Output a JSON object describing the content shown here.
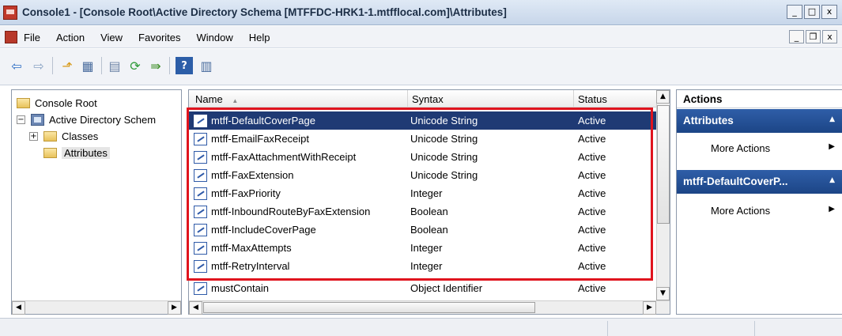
{
  "window": {
    "title": "Console1 - [Console Root\\Active Directory Schema [MTFFDC-HRK1-1.mtfflocal.com]\\Attributes]",
    "controls": [
      "_",
      "□",
      "x"
    ],
    "mdi_controls": [
      "_",
      "ð",
      "x"
    ]
  },
  "menu": {
    "items": [
      "File",
      "Action",
      "View",
      "Favorites",
      "Window",
      "Help"
    ]
  },
  "toolbar": {
    "icons": [
      "back-icon",
      "forward-icon",
      "up-folder-icon",
      "show-hide-tree-icon",
      "properties-icon",
      "refresh-icon",
      "export-icon",
      "help-icon",
      "show-hide-action-pane-icon"
    ]
  },
  "tree": {
    "root": "Console Root",
    "schema": "Active Directory Schem",
    "classes": "Classes",
    "attributes": "Attributes"
  },
  "list": {
    "columns": [
      "Name",
      "Syntax",
      "Status"
    ],
    "sort_indicator": "▲",
    "rows": [
      {
        "name": "mtff-DefaultCoverPage",
        "syntax": "Unicode String",
        "status": "Active"
      },
      {
        "name": "mtff-EmailFaxReceipt",
        "syntax": "Unicode String",
        "status": "Active"
      },
      {
        "name": "mtff-FaxAttachmentWithReceipt",
        "syntax": "Unicode String",
        "status": "Active"
      },
      {
        "name": "mtff-FaxExtension",
        "syntax": "Unicode String",
        "status": "Active"
      },
      {
        "name": "mtff-FaxPriority",
        "syntax": "Integer",
        "status": "Active"
      },
      {
        "name": "mtff-InboundRouteByFaxExtension",
        "syntax": "Boolean",
        "status": "Active"
      },
      {
        "name": "mtff-IncludeCoverPage",
        "syntax": "Boolean",
        "status": "Active"
      },
      {
        "name": "mtff-MaxAttempts",
        "syntax": "Integer",
        "status": "Active"
      },
      {
        "name": "mtff-RetryInterval",
        "syntax": "Integer",
        "status": "Active"
      },
      {
        "name": "mustContain",
        "syntax": "Object Identifier",
        "status": "Active"
      }
    ]
  },
  "actions": {
    "header": "Actions",
    "section1": "Attributes",
    "section1_item": "More Actions",
    "section2": "mtff-DefaultCoverP...",
    "section2_item": "More Actions"
  },
  "colors": {
    "selection": "#1f3a74",
    "highlight_box": "#e0141e",
    "action_header": "#2f5ea8"
  }
}
